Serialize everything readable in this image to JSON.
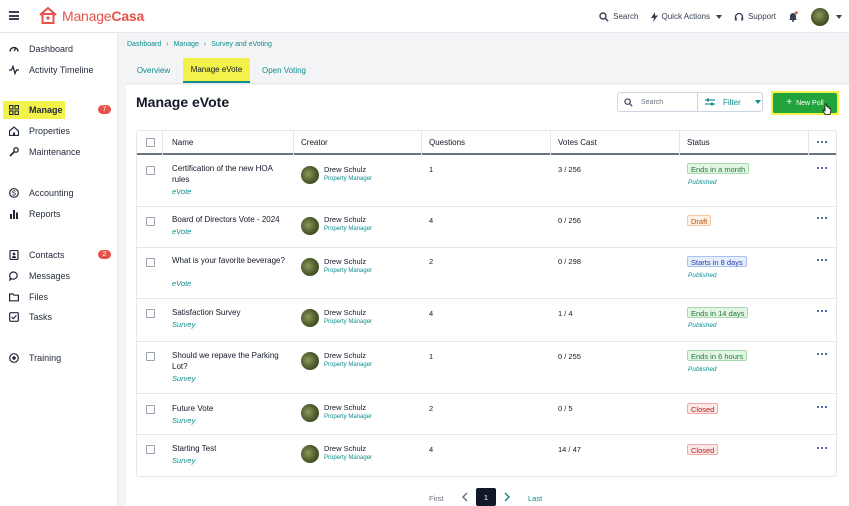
{
  "brand": {
    "prefix": "Manage",
    "suffix": "Casa",
    "color": "#e5534b"
  },
  "topbar": {
    "search_label": "Search",
    "quick_actions_label": "Quick Actions",
    "support_label": "Support"
  },
  "sidebar": {
    "items": [
      {
        "label": "Dashboard",
        "icon": "dashboard-icon"
      },
      {
        "label": "Activity Timeline",
        "icon": "activity-icon"
      },
      {
        "label": "Manage",
        "icon": "grid-icon",
        "badge": "7",
        "active": true
      },
      {
        "label": "Properties",
        "icon": "building-icon"
      },
      {
        "label": "Maintenance",
        "icon": "wrench-icon"
      },
      {
        "label": "Accounting",
        "icon": "dollar-icon"
      },
      {
        "label": "Reports",
        "icon": "bar-chart-icon"
      },
      {
        "label": "Contacts",
        "icon": "address-book-icon",
        "badge": "2"
      },
      {
        "label": "Messages",
        "icon": "chat-icon"
      },
      {
        "label": "Files",
        "icon": "folder-icon"
      },
      {
        "label": "Tasks",
        "icon": "checkbox-icon"
      },
      {
        "label": "Training",
        "icon": "training-icon"
      }
    ]
  },
  "breadcrumb": [
    "Dashboard",
    "Manage",
    "Survey and eVoting"
  ],
  "tabs": [
    {
      "label": "Overview"
    },
    {
      "label": "Manage eVote",
      "active": true
    },
    {
      "label": "Open Voting"
    }
  ],
  "page": {
    "title": "Manage eVote",
    "search_placeholder": "Search",
    "filter_label": "Filter",
    "new_poll_label": "New Poll"
  },
  "table": {
    "headers": [
      "Name",
      "Creator",
      "Questions",
      "Votes Cast",
      "Status"
    ],
    "rows": [
      {
        "name": "Certification of the new HOA rules",
        "type": "eVote",
        "creator": "Drew Schulz",
        "role": "Property Manager",
        "questions": "1",
        "votes": "3 / 256",
        "status": "Ends in a month",
        "status_color": "green",
        "substatus": "Published"
      },
      {
        "name": "Board of Directors Vote - 2024",
        "type": "eVote",
        "creator": "Drew Schulz",
        "role": "Property Manager",
        "questions": "4",
        "votes": "0 / 256",
        "status": "Draft",
        "status_color": "orange",
        "substatus": ""
      },
      {
        "name": "What is your favorite beverage?",
        "type": "eVote",
        "creator": "Drew Schulz",
        "role": "Property Manager",
        "questions": "2",
        "votes": "0 / 298",
        "status": "Starts in 8 days",
        "status_color": "blue",
        "substatus": "Published"
      },
      {
        "name": "Satisfaction Survey",
        "type": "Survey",
        "creator": "Drew Schulz",
        "role": "Property Manager",
        "questions": "4",
        "votes": "1 / 4",
        "status": "Ends in 14 days",
        "status_color": "green",
        "substatus": "Published"
      },
      {
        "name": "Should we repave the Parking Lot?",
        "type": "Survey",
        "creator": "Drew Schulz",
        "role": "Property Manager",
        "questions": "1",
        "votes": "0 / 255",
        "status": "Ends in 6 hours",
        "status_color": "green",
        "substatus": "Published"
      },
      {
        "name": "Future Vote",
        "type": "Survey",
        "creator": "Drew Schulz",
        "role": "Property Manager",
        "questions": "2",
        "votes": "0 / 5",
        "status": "Closed",
        "status_color": "red",
        "substatus": ""
      },
      {
        "name": "Starting Test",
        "type": "Survey",
        "creator": "Drew Schulz",
        "role": "Property Manager",
        "questions": "4",
        "votes": "14 / 47",
        "status": "Closed",
        "status_color": "red",
        "substatus": ""
      }
    ]
  },
  "pagination": {
    "first": "First",
    "current": "1",
    "last": "Last"
  }
}
